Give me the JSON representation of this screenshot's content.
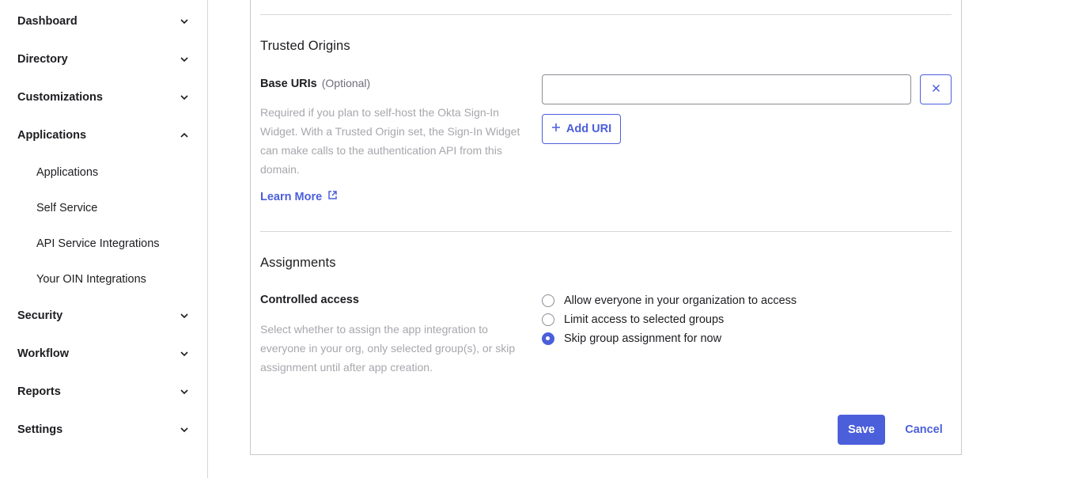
{
  "sidebar": {
    "sections": [
      {
        "label": "Dashboard",
        "icon": "chevron-down-icon"
      },
      {
        "label": "Directory",
        "icon": "chevron-down-icon"
      },
      {
        "label": "Customizations",
        "icon": "chevron-down-icon"
      },
      {
        "label": "Applications",
        "icon": "chevron-up-icon"
      },
      {
        "label": "Security",
        "icon": "chevron-down-icon"
      },
      {
        "label": "Workflow",
        "icon": "chevron-down-icon"
      },
      {
        "label": "Reports",
        "icon": "chevron-down-icon"
      },
      {
        "label": "Settings",
        "icon": "chevron-down-icon"
      }
    ],
    "applications_sub": [
      {
        "label": "Applications"
      },
      {
        "label": "Self Service"
      },
      {
        "label": "API Service Integrations"
      },
      {
        "label": "Your OIN Integrations"
      }
    ]
  },
  "trusted_origins": {
    "title": "Trusted Origins",
    "field_label": "Base URIs",
    "optional": "(Optional)",
    "help": "Required if you plan to self-host the Okta Sign-In Widget. With a Trusted Origin set, the Sign-In Widget can make calls to the authentication API from this domain.",
    "learn_more": "Learn More",
    "uri_value": "",
    "add_uri": "Add URI"
  },
  "assignments": {
    "title": "Assignments",
    "field_label": "Controlled access",
    "help": "Select whether to assign the app integration to everyone in your org, only selected group(s), or skip assignment until after app creation.",
    "options": [
      {
        "label": "Allow everyone in your organization to access",
        "checked": false
      },
      {
        "label": "Limit access to selected groups",
        "checked": false
      },
      {
        "label": "Skip group assignment for now",
        "checked": true
      }
    ]
  },
  "actions": {
    "save": "Save",
    "cancel": "Cancel"
  },
  "colors": {
    "accent": "#4b5fdb",
    "muted_text": "#a7a7ad",
    "border": "#d7d7dc"
  }
}
